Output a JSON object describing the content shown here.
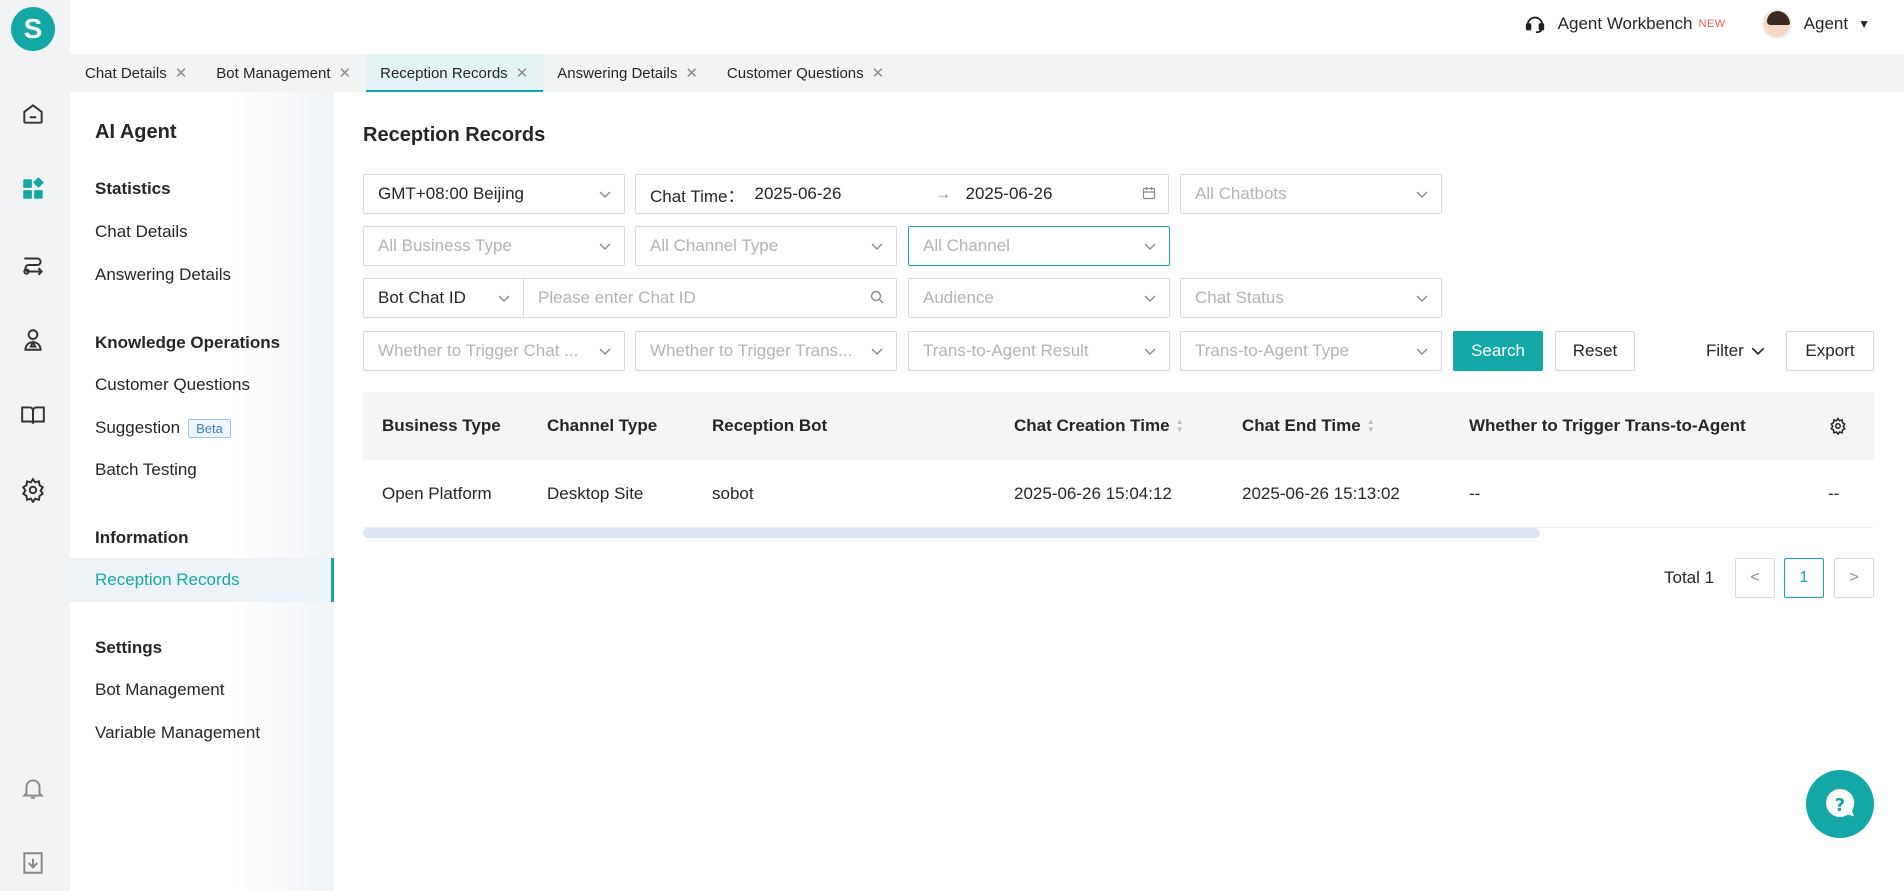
{
  "app": {
    "logo_letter": "S"
  },
  "header": {
    "workbench_label": "Agent Workbench",
    "new_badge": "NEW",
    "user_name": "Agent"
  },
  "tabs": [
    {
      "label": "Chat Details",
      "active": false
    },
    {
      "label": "Bot Management",
      "active": false
    },
    {
      "label": "Reception Records",
      "active": true
    },
    {
      "label": "Answering Details",
      "active": false
    },
    {
      "label": "Customer Questions",
      "active": false
    }
  ],
  "sidebar": {
    "title": "AI Agent",
    "groups": [
      {
        "label": "Statistics",
        "items": [
          "Chat Details",
          "Answering Details"
        ]
      },
      {
        "label": "Knowledge Operations",
        "items": [
          "Customer Questions",
          "Suggestion",
          "Batch Testing"
        ]
      },
      {
        "label": "Information",
        "items": [
          "Reception Records"
        ]
      },
      {
        "label": "Settings",
        "items": [
          "Bot Management",
          "Variable Management"
        ]
      }
    ],
    "beta_badge": "Beta",
    "active_item": "Reception Records"
  },
  "page": {
    "title": "Reception Records"
  },
  "filters": {
    "timezone": "GMT+08:00 Beijing",
    "chat_time_label": "Chat Time：",
    "date_start": "2025-06-26",
    "date_arrow": "→",
    "date_end": "2025-06-26",
    "chatbots_placeholder": "All Chatbots",
    "business_type_placeholder": "All Business Type",
    "channel_type_placeholder": "All Channel Type",
    "channel_placeholder": "All Channel",
    "id_type": "Bot Chat ID",
    "chat_id_placeholder": "Please enter Chat ID",
    "audience_placeholder": "Audience",
    "chat_status_placeholder": "Chat Status",
    "trigger_chat_placeholder": "Whether to Trigger Chat ...",
    "trigger_trans_placeholder": "Whether to Trigger Trans...",
    "trans_result_placeholder": "Trans-to-Agent Result",
    "trans_type_placeholder": "Trans-to-Agent Type",
    "search_button": "Search",
    "reset_button": "Reset",
    "filter_link": "Filter",
    "export_button": "Export"
  },
  "table": {
    "columns": [
      "Business Type",
      "Channel Type",
      "Reception Bot",
      "Chat Creation Time",
      "Chat End Time",
      "Whether to Trigger Trans-to-Agent"
    ],
    "rows": [
      [
        "Open Platform",
        "Desktop Site",
        "sobot",
        "2025-06-26 15:04:12",
        "2025-06-26 15:13:02",
        "--",
        "--"
      ]
    ]
  },
  "pagination": {
    "total_label": "Total 1",
    "current_page": "1",
    "prev": "<",
    "next": ">"
  },
  "colors": {
    "accent": "#13a8a6",
    "rail_bg": "#f2f3f5"
  }
}
